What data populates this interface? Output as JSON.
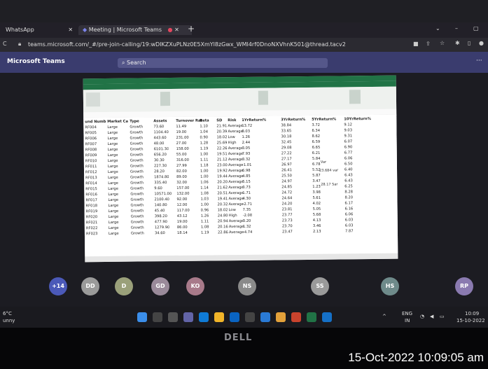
{
  "browser": {
    "tabs": [
      {
        "label": "WhatsApp"
      },
      {
        "label": "Meeting | Microsoft Teams"
      }
    ],
    "url": "teams.microsoft.com/_#/pre-join-calling/19:wDIKZXuPLNz0E5XmYl8zGwx_WMI4rf0DnoNXVhnK501@thread.tacv2"
  },
  "teams": {
    "app_title": "Microsoft Teams",
    "search_placeholder": "Search"
  },
  "excel": {
    "columns": [
      "und Numb",
      "Market Ca",
      "Type",
      "Assets",
      "Turnover Rat",
      "Beta",
      "SD",
      "Risk",
      "1YrReturn%",
      "3YrReturn%",
      "5YrReturn%",
      "10YrReturn%"
    ],
    "rows": [
      [
        "RF004",
        "Large",
        "Growth",
        "73.60",
        "11.49",
        "1.10",
        "21.91",
        "Average",
        "13.72",
        "38.84",
        "3.72",
        "9.12"
      ],
      [
        "RF005",
        "Large",
        "Growth",
        "1104.40",
        "19.00",
        "1.04",
        "20.39",
        "Average",
        "8.03",
        "33.65",
        "6.34",
        "9.03"
      ],
      [
        "RF006",
        "Large",
        "Growth",
        "443.60",
        "231.00",
        "0.90",
        "18.02",
        "Low",
        "1.26",
        "30.18",
        "8.62",
        "9.31"
      ],
      [
        "RF007",
        "Large",
        "Growth",
        "48.00",
        "27.00",
        "1.28",
        "25.69",
        "High",
        "2.44",
        "32.45",
        "6.59",
        "6.07"
      ],
      [
        "RF008",
        "Large",
        "Growth",
        "6101.30",
        "158.00",
        "1.19",
        "22.26",
        "Average",
        "3.05",
        "29.08",
        "6.65",
        "6.90"
      ],
      [
        "RF009",
        "Large",
        "Growth",
        "656.20",
        "55.00",
        "1.00",
        "19.51",
        "Average",
        "7.93",
        "27.22",
        "6.21",
        "6.77"
      ],
      [
        "RF010",
        "Large",
        "Growth",
        "30.30",
        "316.00",
        "1.11",
        "21.12",
        "Average",
        "3.32",
        "27.17",
        "5.84",
        "6.06"
      ],
      [
        "RF011",
        "Large",
        "Growth",
        "227.30",
        "27.99",
        "1.18",
        "23.00",
        "Average",
        "-1.01",
        "26.97",
        "6.78",
        "6.50"
      ],
      [
        "RF012",
        "Large",
        "Growth",
        "28.20",
        "82.00",
        "1.00",
        "19.92",
        "Average",
        "6.98",
        "26.41",
        "5.52",
        "6.40"
      ],
      [
        "RF013",
        "Large",
        "Growth",
        "1874.80",
        "89.00",
        "1.00",
        "19.44",
        "Average",
        "4.85",
        "25.50",
        "5.87",
        "6.43"
      ],
      [
        "RF014",
        "Large",
        "Growth",
        "335.40",
        "32.00",
        "1.06",
        "20.20",
        "Average",
        "5.15",
        "24.97",
        "3.47",
        "6.43"
      ],
      [
        "RF015",
        "Large",
        "Growth",
        "9.60",
        "157.00",
        "1.14",
        "21.62",
        "Average",
        "3.73",
        "24.85",
        "1.23",
        "6.25"
      ],
      [
        "RF016",
        "Large",
        "Growth",
        "10571.00",
        "132.00",
        "1.08",
        "20.51",
        "Average",
        "1.71",
        "24.72",
        "3.98",
        "8.28"
      ],
      [
        "RF017",
        "Large",
        "Growth",
        "2100.40",
        "92.00",
        "1.03",
        "19.41",
        "Average",
        "4.30",
        "24.64",
        "5.61",
        "8.20"
      ],
      [
        "RF018",
        "Large",
        "Growth",
        "140.80",
        "12.00",
        "1.00",
        "20.32",
        "Average",
        "-2.71",
        "24.20",
        "4.02",
        "6.17"
      ],
      [
        "RF019",
        "Large",
        "Growth",
        "45.40",
        "117.00",
        "0.96",
        "18.02",
        "Low",
        "7.35",
        "23.81",
        "5.05",
        "6.16"
      ],
      [
        "RF020",
        "Large",
        "Growth",
        "398.20",
        "43.12",
        "1.26",
        "24.80",
        "High",
        "-2.08",
        "23.77",
        "5.68",
        "6.06"
      ],
      [
        "RF021",
        "Large",
        "Growth",
        "477.90",
        "19.00",
        "1.11",
        "20.94",
        "Average",
        "3.20",
        "23.73",
        "4.13",
        "6.03"
      ],
      [
        "RF022",
        "Large",
        "Growth",
        "1279.90",
        "86.00",
        "1.08",
        "20.16",
        "Average",
        "1.32",
        "23.70",
        "3.46",
        "6.03"
      ],
      [
        "RF023",
        "Large",
        "Growth",
        "34.60",
        "18.14",
        "1.19",
        "22.86",
        "Average",
        "-4.74",
        "23.47",
        "2.13",
        "7.87"
      ]
    ],
    "side_notes": [
      "Var",
      "23.684 var",
      "28.17 Sar"
    ]
  },
  "participants": [
    {
      "initials": "+14",
      "color": "#4b59b8"
    },
    {
      "initials": "DD",
      "color": "#9a9a9a"
    },
    {
      "initials": "D",
      "color": "#9aa07a"
    },
    {
      "initials": "GD",
      "color": "#9a8a9a"
    },
    {
      "initials": "KO",
      "color": "#a87a8a"
    },
    {
      "initials": "NS",
      "color": "#8a8a8a"
    },
    {
      "initials": "SS",
      "color": "#9a9a9a"
    },
    {
      "initials": "HS",
      "color": "#6e8a8a"
    },
    {
      "initials": "RP",
      "color": "#8a7ab0"
    }
  ],
  "taskbar": {
    "weather_temp": "6°C",
    "weather_text": "unny",
    "lang": "ENG",
    "lang_sub": "IN",
    "time": "10:09",
    "date": "15-10-2022"
  },
  "bezel": {
    "brand": "DELL",
    "timestamp": "15-Oct-2022 10:09:05 am"
  },
  "colors": {
    "teams_bar": "#3a3c6e",
    "excel_green": "#217346",
    "record_dot": "#e3475f"
  }
}
